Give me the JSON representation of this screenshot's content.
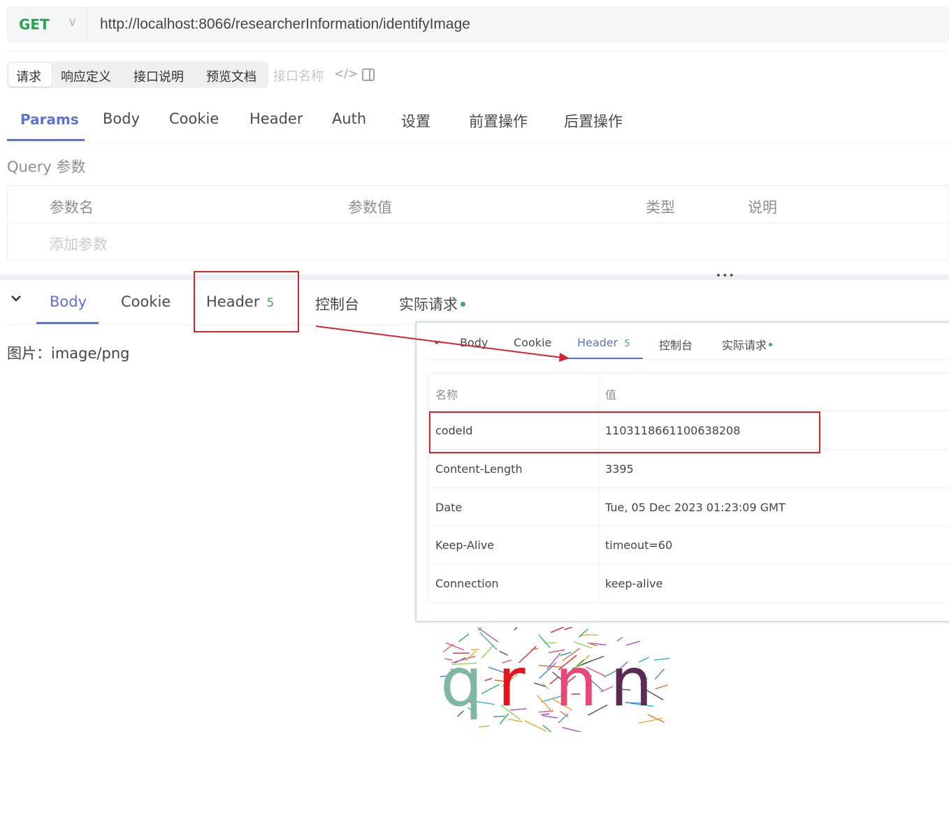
{
  "request": {
    "method": "GET",
    "url": "http://localhost:8066/researcherInformation/identifyImage"
  },
  "segment_tabs": [
    "请求",
    "响应定义",
    "接口说明",
    "预览文档"
  ],
  "interface_name_placeholder": "接口名称",
  "request_tabs": [
    "Params",
    "Body",
    "Cookie",
    "Header",
    "Auth",
    "设置",
    "前置操作",
    "后置操作"
  ],
  "query": {
    "label": "Query 参数",
    "columns": [
      "参数名",
      "参数值",
      "类型",
      "说明"
    ],
    "add_placeholder": "添加参数"
  },
  "response": {
    "tabs": {
      "body": "Body",
      "cookie": "Cookie",
      "header": "Header",
      "header_count": "5",
      "console": "控制台",
      "actual_request": "实际请求"
    },
    "content_type_label": "图片：image/png"
  },
  "popup": {
    "tabs": {
      "body": "Body",
      "cookie": "Cookie",
      "header": "Header",
      "header_count": "5",
      "console": "控制台",
      "actual_request": "实际请求"
    },
    "table": {
      "columns": [
        "名称",
        "值"
      ],
      "rows": [
        {
          "name": "codeId",
          "value": "1103118661100638208"
        },
        {
          "name": "Content-Length",
          "value": "3395"
        },
        {
          "name": "Date",
          "value": "Tue, 05 Dec 2023 01:23:09 GMT"
        },
        {
          "name": "Keep-Alive",
          "value": "timeout=60"
        },
        {
          "name": "Connection",
          "value": "keep-alive"
        }
      ]
    }
  },
  "captcha": {
    "characters": [
      "q",
      "r",
      "n",
      "n"
    ],
    "colors": [
      "#7fb8a2",
      "#e8141c",
      "#e8477a",
      "#5b2a55"
    ]
  },
  "colors": {
    "accent": "#5b73d6",
    "method_get": "#22a84e",
    "highlight": "#d9232b",
    "badge": "#3fae5a"
  }
}
